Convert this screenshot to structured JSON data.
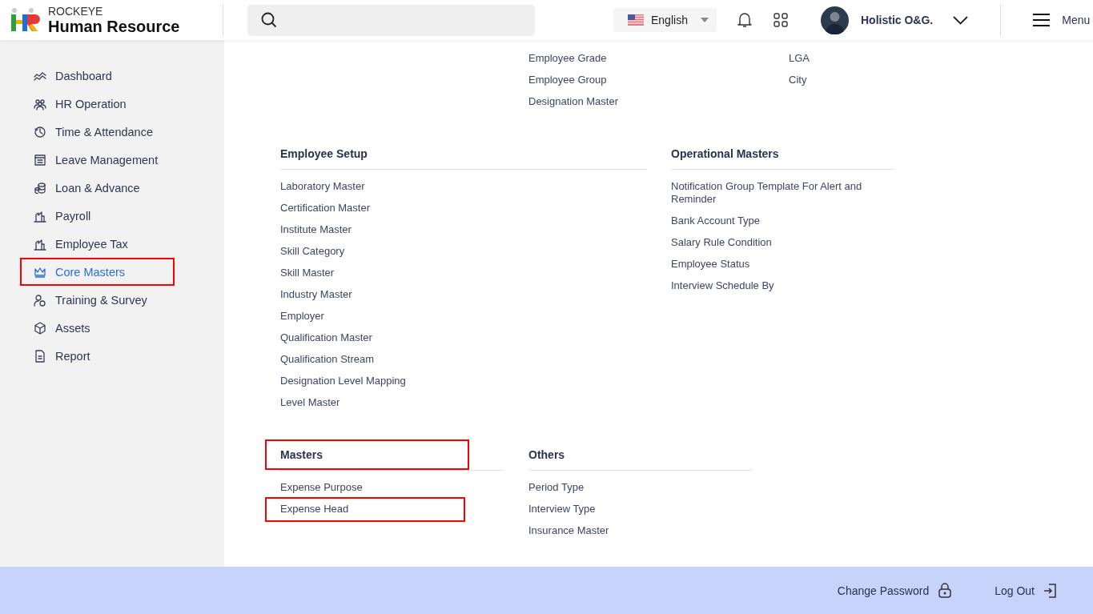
{
  "header": {
    "brand_top": "ROCKEYE",
    "brand_name": "Human Resource",
    "language": "English",
    "user": "Holistic O&G.",
    "menu": "Menu"
  },
  "sidebar": {
    "items": [
      {
        "label": "Dashboard",
        "selected": false,
        "highlighted": false
      },
      {
        "label": "HR Operation",
        "selected": false,
        "highlighted": false
      },
      {
        "label": "Time & Attendance",
        "selected": false,
        "highlighted": false
      },
      {
        "label": "Leave Management",
        "selected": false,
        "highlighted": false
      },
      {
        "label": "Loan & Advance",
        "selected": false,
        "highlighted": false
      },
      {
        "label": "Payroll",
        "selected": false,
        "highlighted": false
      },
      {
        "label": "Employee Tax",
        "selected": false,
        "highlighted": false
      },
      {
        "label": "Core Masters",
        "selected": true,
        "highlighted": true
      },
      {
        "label": "Training & Survey",
        "selected": false,
        "highlighted": false
      },
      {
        "label": "Assets",
        "selected": false,
        "highlighted": false
      },
      {
        "label": "Report",
        "selected": false,
        "highlighted": false
      }
    ]
  },
  "top_lists": [
    {
      "items": [
        "Employee Grade",
        "Employee Group",
        "Designation Master"
      ]
    },
    {
      "items": [
        "LGA",
        "City"
      ]
    }
  ],
  "section_rows": [
    [
      {
        "title": "Employee Setup",
        "highlighted": false,
        "items": [
          {
            "label": "Laboratory Master",
            "highlighted": false
          },
          {
            "label": "Certification Master",
            "highlighted": false
          },
          {
            "label": "Institute Master",
            "highlighted": false
          },
          {
            "label": "Skill Category",
            "highlighted": false
          },
          {
            "label": "Skill Master",
            "highlighted": false
          },
          {
            "label": "Industry Master",
            "highlighted": false
          },
          {
            "label": "Employer",
            "highlighted": false
          },
          {
            "label": "Qualification Master",
            "highlighted": false
          },
          {
            "label": "Qualification Stream",
            "highlighted": false
          },
          {
            "label": "Designation Level Mapping",
            "highlighted": false
          },
          {
            "label": "Level Master",
            "highlighted": false
          }
        ]
      },
      {
        "title": "Operational Masters",
        "highlighted": false,
        "items": [
          {
            "label": "Notification Group Template For Alert and Reminder",
            "highlighted": false
          },
          {
            "label": "Bank Account Type",
            "highlighted": false
          },
          {
            "label": "Salary Rule Condition",
            "highlighted": false
          },
          {
            "label": "Employee Status",
            "highlighted": false
          },
          {
            "label": "Interview Schedule By",
            "highlighted": false
          }
        ]
      }
    ],
    [
      {
        "title": "Masters",
        "highlighted": true,
        "items": [
          {
            "label": "Expense Purpose",
            "highlighted": false
          },
          {
            "label": "Expense Head",
            "highlighted": true
          }
        ]
      },
      {
        "title": "Others",
        "highlighted": false,
        "items": [
          {
            "label": "Period Type",
            "highlighted": false
          },
          {
            "label": "Interview Type",
            "highlighted": false
          },
          {
            "label": "Insurance Master",
            "highlighted": false
          }
        ]
      }
    ]
  ],
  "footer": [
    {
      "label": "Change Password",
      "kind": "lock"
    },
    {
      "label": "Log Out",
      "kind": "logout"
    }
  ]
}
